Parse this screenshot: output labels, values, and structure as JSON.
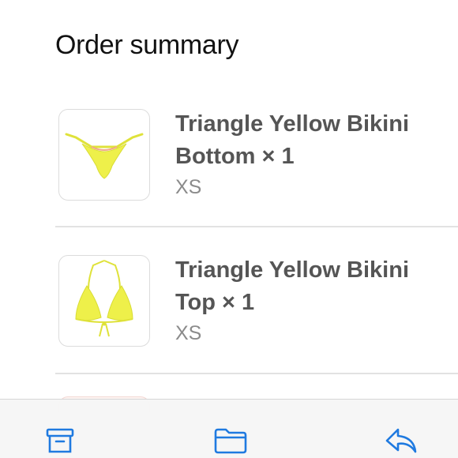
{
  "header": {
    "title": "Order summary"
  },
  "order_items": [
    {
      "name": "Triangle Yellow Bikini Bottom × 1",
      "variant": "XS",
      "icon": "bikini-bottom-image"
    },
    {
      "name": "Triangle Yellow Bikini Top × 1",
      "variant": "XS",
      "icon": "bikini-top-image"
    }
  ],
  "toolbar": {
    "buttons": [
      {
        "icon": "archive-icon"
      },
      {
        "icon": "folder-icon"
      },
      {
        "icon": "reply-icon"
      }
    ]
  },
  "colors": {
    "accent": "#1f7ae0",
    "product_yellow": "#eef04a"
  }
}
